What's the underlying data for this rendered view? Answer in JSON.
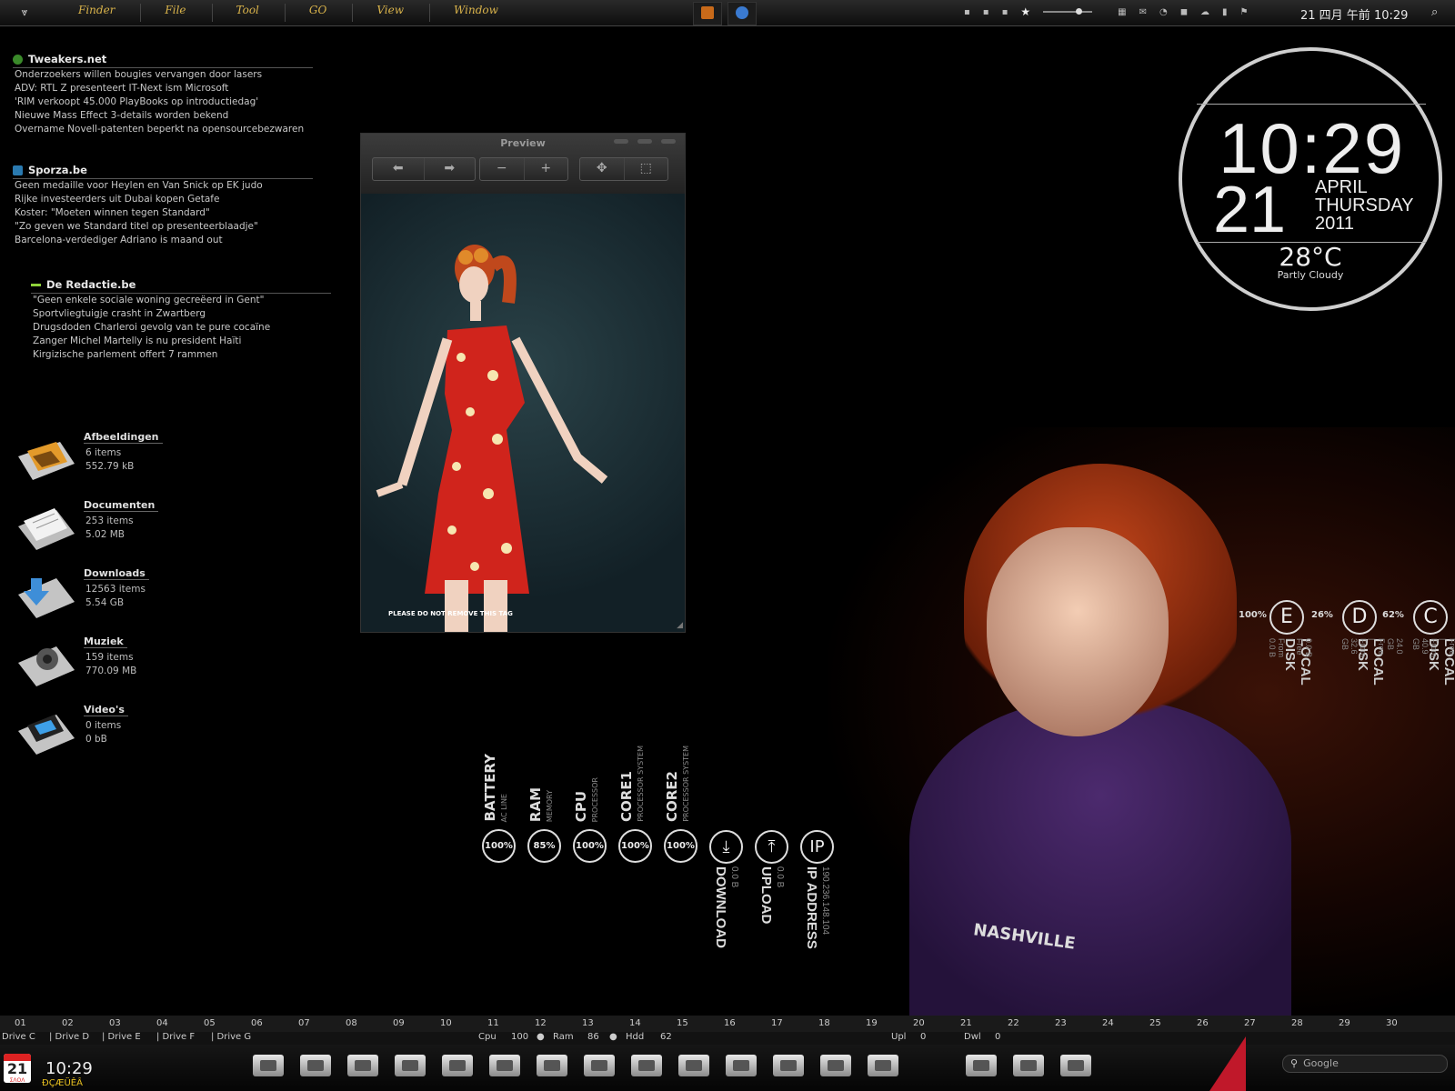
{
  "menubar": {
    "menus": [
      "Finder",
      "File",
      "Tool",
      "GO",
      "View",
      "Window"
    ],
    "date_time": "21 四月  午前 10:29",
    "icons": [
      "apple-logo-icon",
      "photo-app-icon",
      "globe-app-icon",
      "bullet-icon",
      "bullet-icon",
      "bullet-icon",
      "star-icon",
      "volume-slider-icon",
      "display-icon",
      "mail-icon",
      "rss-icon",
      "chat-icon",
      "cloud-icon",
      "battery-icon",
      "flag-icon",
      "spotlight-icon"
    ]
  },
  "news": [
    {
      "source": "Tweakers.net",
      "color": "#3a8a2a",
      "items": [
        "Onderzoekers willen bougies vervangen door lasers",
        "ADV: RTL Z presenteert IT-Next ism Microsoft",
        "'RIM verkoopt 45.000 PlayBooks op introductiedag'",
        "Nieuwe Mass Effect 3-details worden bekend",
        "Overname Novell-patenten beperkt na opensourcebezwaren"
      ]
    },
    {
      "source": "Sporza.be",
      "color": "#2a7ab0",
      "items": [
        "Geen medaille voor Heylen en Van Snick op EK judo",
        "Rijke investeerders uit Dubai kopen Getafe",
        "Koster: \"Moeten winnen tegen Standard\"",
        "\"Zo geven we Standard titel op presenteerblaadje\"",
        "Barcelona-verdediger Adriano is maand out"
      ]
    },
    {
      "source": "De Redactie.be",
      "color": "#8fd23a",
      "items": [
        "\"Geen enkele sociale woning gecreëerd in Gent\"",
        "Sportvliegtuigje crasht in Zwartberg",
        "Drugsdoden Charleroi gevolg van te pure cocaïne",
        "Zanger Michel Martelly is nu president Haïti",
        "Kirgizische parlement offert 7 rammen"
      ]
    }
  ],
  "folders": [
    {
      "name": "Afbeeldingen",
      "items": "6 items",
      "size": "552.79 kB"
    },
    {
      "name": "Documenten",
      "items": "253 items",
      "size": "5.02 MB"
    },
    {
      "name": "Downloads",
      "items": "12563 items",
      "size": "5.54 GB"
    },
    {
      "name": "Muziek",
      "items": "159 items",
      "size": "770.09 MB"
    },
    {
      "name": "Video's",
      "items": "0 items",
      "size": "0 bB"
    }
  ],
  "preview": {
    "title": "Preview",
    "tag": "PLEASE DO NOT REMOVE THIS TAG"
  },
  "clock": {
    "time": "10:29",
    "day": "21",
    "month": "APRIL",
    "weekday": "THURSDAY",
    "year": "2011",
    "temp": "28°C",
    "condition": "Partly Cloudy"
  },
  "drives": [
    {
      "letter": "E",
      "percent": "100%",
      "label": "LOCAL DISK",
      "detail": "0.0 B Free | From 0.0 B"
    },
    {
      "letter": "D",
      "percent": "26%",
      "label": "LOCAL DISK",
      "detail": "24.0 GB Free | From 32.6 GB"
    },
    {
      "letter": "C",
      "percent": "62%",
      "label": "LOCAL DISK",
      "detail": "15.4 GB Free | From 40.9 GB"
    }
  ],
  "monitors": [
    {
      "label": "BATTERY",
      "sub": "AC LINE",
      "value": "100%"
    },
    {
      "label": "RAM",
      "sub": "MEMORY",
      "value": "85%"
    },
    {
      "label": "CPU",
      "sub": "PROCESSOR",
      "value": "100%"
    },
    {
      "label": "CORE1",
      "sub": "PROCESSOR SYSTEM",
      "value": "100%"
    },
    {
      "label": "CORE2",
      "sub": "PROCESSOR SYSTEM",
      "value": "100%"
    }
  ],
  "network": [
    {
      "label": "DOWNLOAD",
      "value": "0.0 B",
      "glyph": "⤓"
    },
    {
      "label": "UPLOAD",
      "value": "0.0 B",
      "glyph": "⤒"
    },
    {
      "label": "IP ADDRESS",
      "value": "190.236.148.104",
      "glyph": "IP"
    }
  ],
  "wallpaper": {
    "shirt_text": "NASHVILLE"
  },
  "daybar": [
    "01",
    "02",
    "03",
    "04",
    "05",
    "06",
    "07",
    "08",
    "09",
    "10",
    "11",
    "12",
    "13",
    "14",
    "15",
    "16",
    "17",
    "18",
    "19",
    "20",
    "21",
    "22",
    "23",
    "24",
    "25",
    "26",
    "27",
    "28",
    "29",
    "30"
  ],
  "infobar": {
    "drives": [
      "Drive C",
      "| Drive D",
      "| Drive E",
      "| Drive F",
      "| Drive G"
    ],
    "cpu_label": "Cpu",
    "cpu": "100",
    "ram_label": "Ram",
    "ram": "86",
    "hdd_label": "Hdd",
    "hdd": "62",
    "upl_label": "Upl",
    "upl": "0",
    "dwl_label": "Dwl",
    "dwl": "0"
  },
  "dock": {
    "date": "21",
    "month": "ΣΛΟΛ",
    "time": "10:29",
    "sub": "ÐÇÆÜÊÂ",
    "items": [
      "documents-folder-icon",
      "users-folder-icon",
      "pictures-folder-icon",
      "photoshop-folder-icon",
      "music-folder-icon",
      "applications-folder-icon",
      "downloads-folder-icon",
      "itunes-folder-icon",
      "tools-folder-icon",
      "settings-folder-icon",
      "photo-folder-icon",
      "public-folder-icon",
      "favorites-folder-icon",
      "desktop-folder-icon",
      "search-folder-icon",
      "library-folder-icon",
      "games-folder-icon"
    ],
    "search_placeholder": "Google"
  }
}
